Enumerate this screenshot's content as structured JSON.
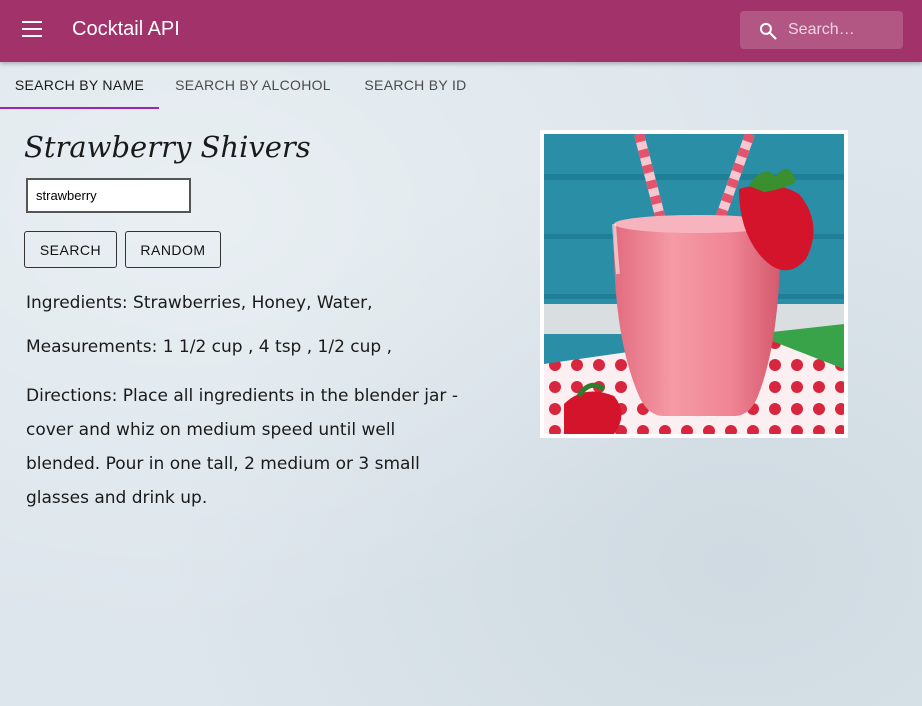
{
  "appbar": {
    "title": "Cocktail API",
    "search_placeholder": "Search…",
    "color": "#a2326a"
  },
  "tabs": [
    {
      "label": "SEARCH BY NAME",
      "active": true
    },
    {
      "label": "SEARCH BY ALCOHOL",
      "active": false
    },
    {
      "label": "SEARCH BY ID",
      "active": false
    }
  ],
  "drink": {
    "name": "Strawberry Shivers",
    "search_value": "strawberry",
    "search_button": "SEARCH",
    "random_button": "RANDOM",
    "ingredients": "Ingredients: Strawberries, Honey, Water,",
    "measurements": "Measurements: 1 1/2 cup , 4 tsp , 1/2 cup ,",
    "directions": "Directions: Place all ingredients in the blender jar - cover and whiz on medium speed until well blended. Pour in one tall, 2 medium or 3 small glasses and drink up."
  },
  "icons": {
    "menu": "menu-icon",
    "search": "search-icon"
  }
}
